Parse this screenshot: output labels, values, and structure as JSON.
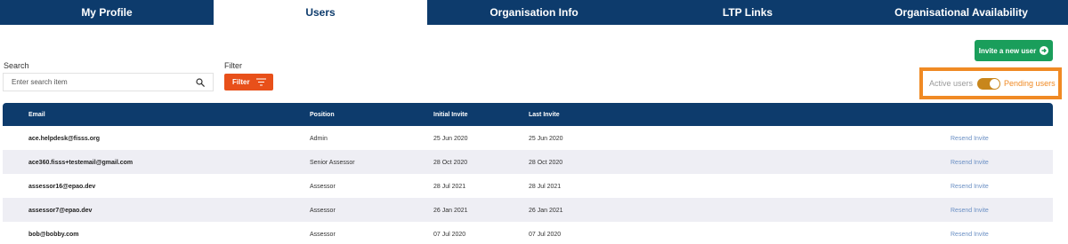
{
  "tabs": [
    {
      "label": "My Profile",
      "active": false
    },
    {
      "label": "Users",
      "active": true
    },
    {
      "label": "Organisation Info",
      "active": false
    },
    {
      "label": "LTP Links",
      "active": false
    },
    {
      "label": "Organisational Availability",
      "active": false
    }
  ],
  "invite_button": {
    "label": "Invite a new user",
    "icon": "plus-circle-icon",
    "color": "#1a9e5b"
  },
  "search": {
    "label": "Search",
    "placeholder": "Enter search item",
    "value": "",
    "icon": "search-icon"
  },
  "filter": {
    "label": "Filter",
    "button_label": "Filter",
    "icon": "filter-lines-icon",
    "color": "#e8501a"
  },
  "toggle": {
    "left_label": "Active users",
    "right_label": "Pending users",
    "state": "pending",
    "highlight_color": "#f08a24"
  },
  "table": {
    "headers": {
      "email": "Email",
      "position": "Position",
      "initial_invite": "Initial Invite",
      "last_invite": "Last Invite"
    },
    "rows": [
      {
        "email": "ace.helpdesk@fisss.org",
        "position": "Admin",
        "initial_invite": "25 Jun 2020",
        "last_invite": "25 Jun 2020",
        "action": "Resend Invite"
      },
      {
        "email": "ace360.fisss+testemail@gmail.com",
        "position": "Senior Assessor",
        "initial_invite": "28 Oct 2020",
        "last_invite": "28 Oct 2020",
        "action": "Resend Invite"
      },
      {
        "email": "assessor16@epao.dev",
        "position": "Assessor",
        "initial_invite": "28 Jul 2021",
        "last_invite": "28 Jul 2021",
        "action": "Resend Invite"
      },
      {
        "email": "assessor7@epao.dev",
        "position": "Assessor",
        "initial_invite": "26 Jan 2021",
        "last_invite": "26 Jan 2021",
        "action": "Resend Invite"
      },
      {
        "email": "bob@bobby.com",
        "position": "Assessor",
        "initial_invite": "07 Jul 2020",
        "last_invite": "07 Jul 2020",
        "action": "Resend Invite"
      }
    ]
  },
  "colors": {
    "header_navy": "#0d3b6c",
    "row_alt": "#eeeef4",
    "link": "#6a8fc4"
  }
}
